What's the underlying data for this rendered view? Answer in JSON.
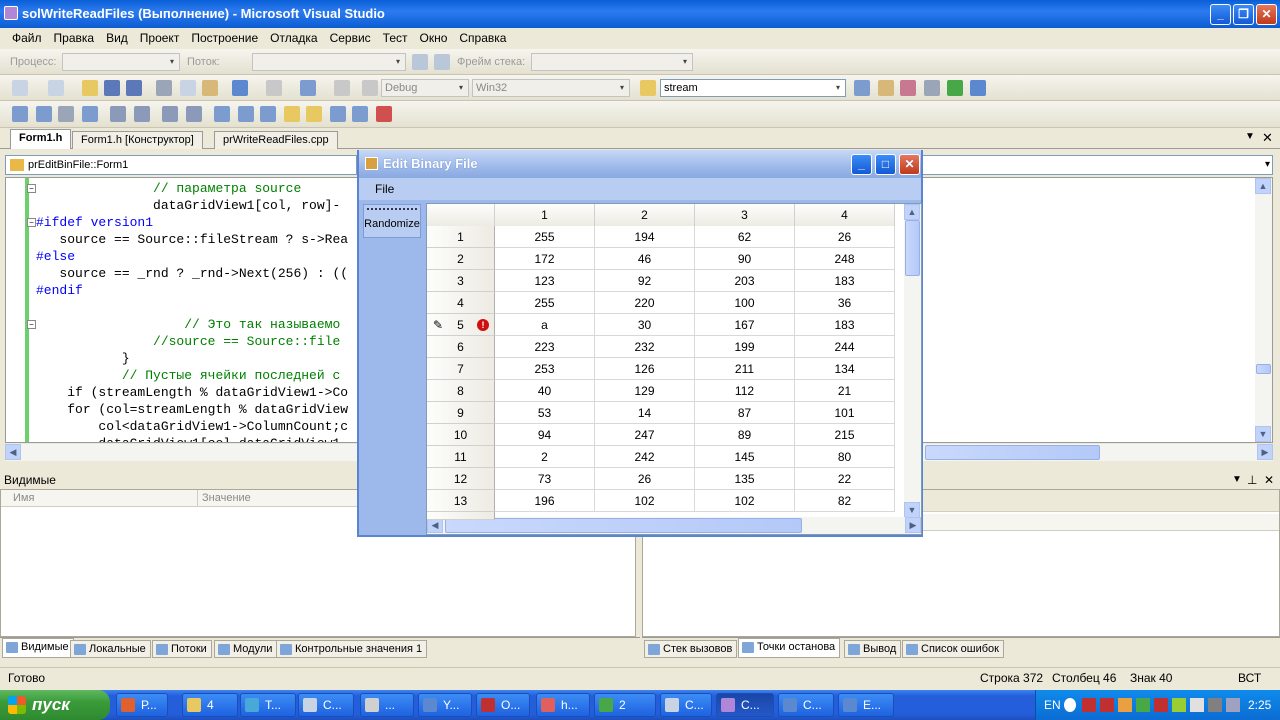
{
  "window": {
    "title": "solWriteReadFiles (Выполнение) - Microsoft Visual Studio"
  },
  "menu": [
    "Файл",
    "Правка",
    "Вид",
    "Проект",
    "Построение",
    "Отладка",
    "Сервис",
    "Тест",
    "Окно",
    "Справка"
  ],
  "debugbar": {
    "process_label": "Процесс:",
    "thread_label": "Поток:",
    "frame_label": "Фрейм стека:"
  },
  "toolbar": {
    "config": "Debug",
    "platform": "Win32",
    "find": "stream"
  },
  "doc_tabs": [
    "Form1.h",
    "Form1.h [Конструктор]",
    "prWriteReadFiles.cpp"
  ],
  "nav": {
    "class_combo": "prEditBinFile::Form1"
  },
  "code_lines": [
    {
      "indent": "               ",
      "text": "// параметра source",
      "type": "cm"
    },
    {
      "indent": "               ",
      "text": "dataGridView1[col, row]-",
      "type": "code"
    },
    {
      "indent": "",
      "text": "#ifdef version1",
      "type": "pre"
    },
    {
      "indent": "   ",
      "text": "source == Source::fileStream ? s->Rea",
      "type": "code"
    },
    {
      "indent": "",
      "text": "#else",
      "type": "pre"
    },
    {
      "indent": "   ",
      "text": "source == _rnd ? _rnd->Next(256) : ((",
      "type": "code"
    },
    {
      "indent": "",
      "text": "#endif",
      "type": "pre"
    },
    {
      "indent": "",
      "text": "",
      "type": "code"
    },
    {
      "indent": "                   ",
      "text": "// Это так называемо",
      "type": "cm"
    },
    {
      "indent": "               ",
      "text": "//source == Source::file",
      "type": "cm"
    },
    {
      "indent": "           ",
      "text": "}",
      "type": "code"
    },
    {
      "indent": "           ",
      "text": "// Пустые ячейки последней с",
      "type": "cm"
    },
    {
      "indent": "    ",
      "text": "if (streamLength % dataGridView1->Co",
      "type": "code"
    },
    {
      "indent": "    ",
      "text": "for (col=streamLength % dataGridView",
      "type": "code"
    },
    {
      "indent": "        ",
      "text": "col<dataGridView1->ColumnCount;c",
      "type": "code"
    },
    {
      "indent": "        ",
      "text": "dataGridView1[col,dataGridView1-",
      "type": "code"
    }
  ],
  "watch": {
    "title": "Видимые",
    "col_name": "Имя",
    "col_value": "Значение"
  },
  "bottom_tabs_left": [
    "Видимые",
    "Локальные",
    "Потоки",
    "Модули",
    "Контрольные значения 1"
  ],
  "bottom_tabs_right": [
    "Стек вызовов",
    "Точки останова",
    "Вывод",
    "Список ошибок"
  ],
  "status": {
    "ready": "Готово",
    "line": "Строка 372",
    "col": "Столбец 46",
    "char": "Знак 40",
    "mode": "ВСТ"
  },
  "dialog": {
    "title": "Edit Binary File",
    "menu_file": "File",
    "randomize_label": "Randomize",
    "columns": [
      "1",
      "2",
      "3",
      "4"
    ],
    "rows": [
      {
        "n": "1",
        "v": [
          "255",
          "194",
          "62",
          "26"
        ]
      },
      {
        "n": "2",
        "v": [
          "172",
          "46",
          "90",
          "248"
        ]
      },
      {
        "n": "3",
        "v": [
          "123",
          "92",
          "203",
          "183"
        ]
      },
      {
        "n": "4",
        "v": [
          "255",
          "220",
          "100",
          "36"
        ]
      },
      {
        "n": "5",
        "v": [
          "a",
          "30",
          "167",
          "183"
        ],
        "editing": true,
        "error": true
      },
      {
        "n": "6",
        "v": [
          "223",
          "232",
          "199",
          "244"
        ]
      },
      {
        "n": "7",
        "v": [
          "253",
          "126",
          "211",
          "134"
        ]
      },
      {
        "n": "8",
        "v": [
          "40",
          "129",
          "112",
          "21"
        ]
      },
      {
        "n": "9",
        "v": [
          "53",
          "14",
          "87",
          "101"
        ]
      },
      {
        "n": "10",
        "v": [
          "94",
          "247",
          "89",
          "215"
        ]
      },
      {
        "n": "11",
        "v": [
          "2",
          "242",
          "145",
          "80"
        ]
      },
      {
        "n": "12",
        "v": [
          "73",
          "26",
          "135",
          "22"
        ]
      },
      {
        "n": "13",
        "v": [
          "196",
          "102",
          "102",
          "82"
        ]
      }
    ]
  },
  "taskbar": {
    "start": "пуск",
    "tasks": [
      "Р...",
      "4",
      "Т...",
      "С...",
      "...",
      "Y...",
      "О...",
      "h...",
      "2",
      "С...",
      "С...",
      "С...",
      "E..."
    ],
    "lang": "EN",
    "clock": "2:25"
  }
}
